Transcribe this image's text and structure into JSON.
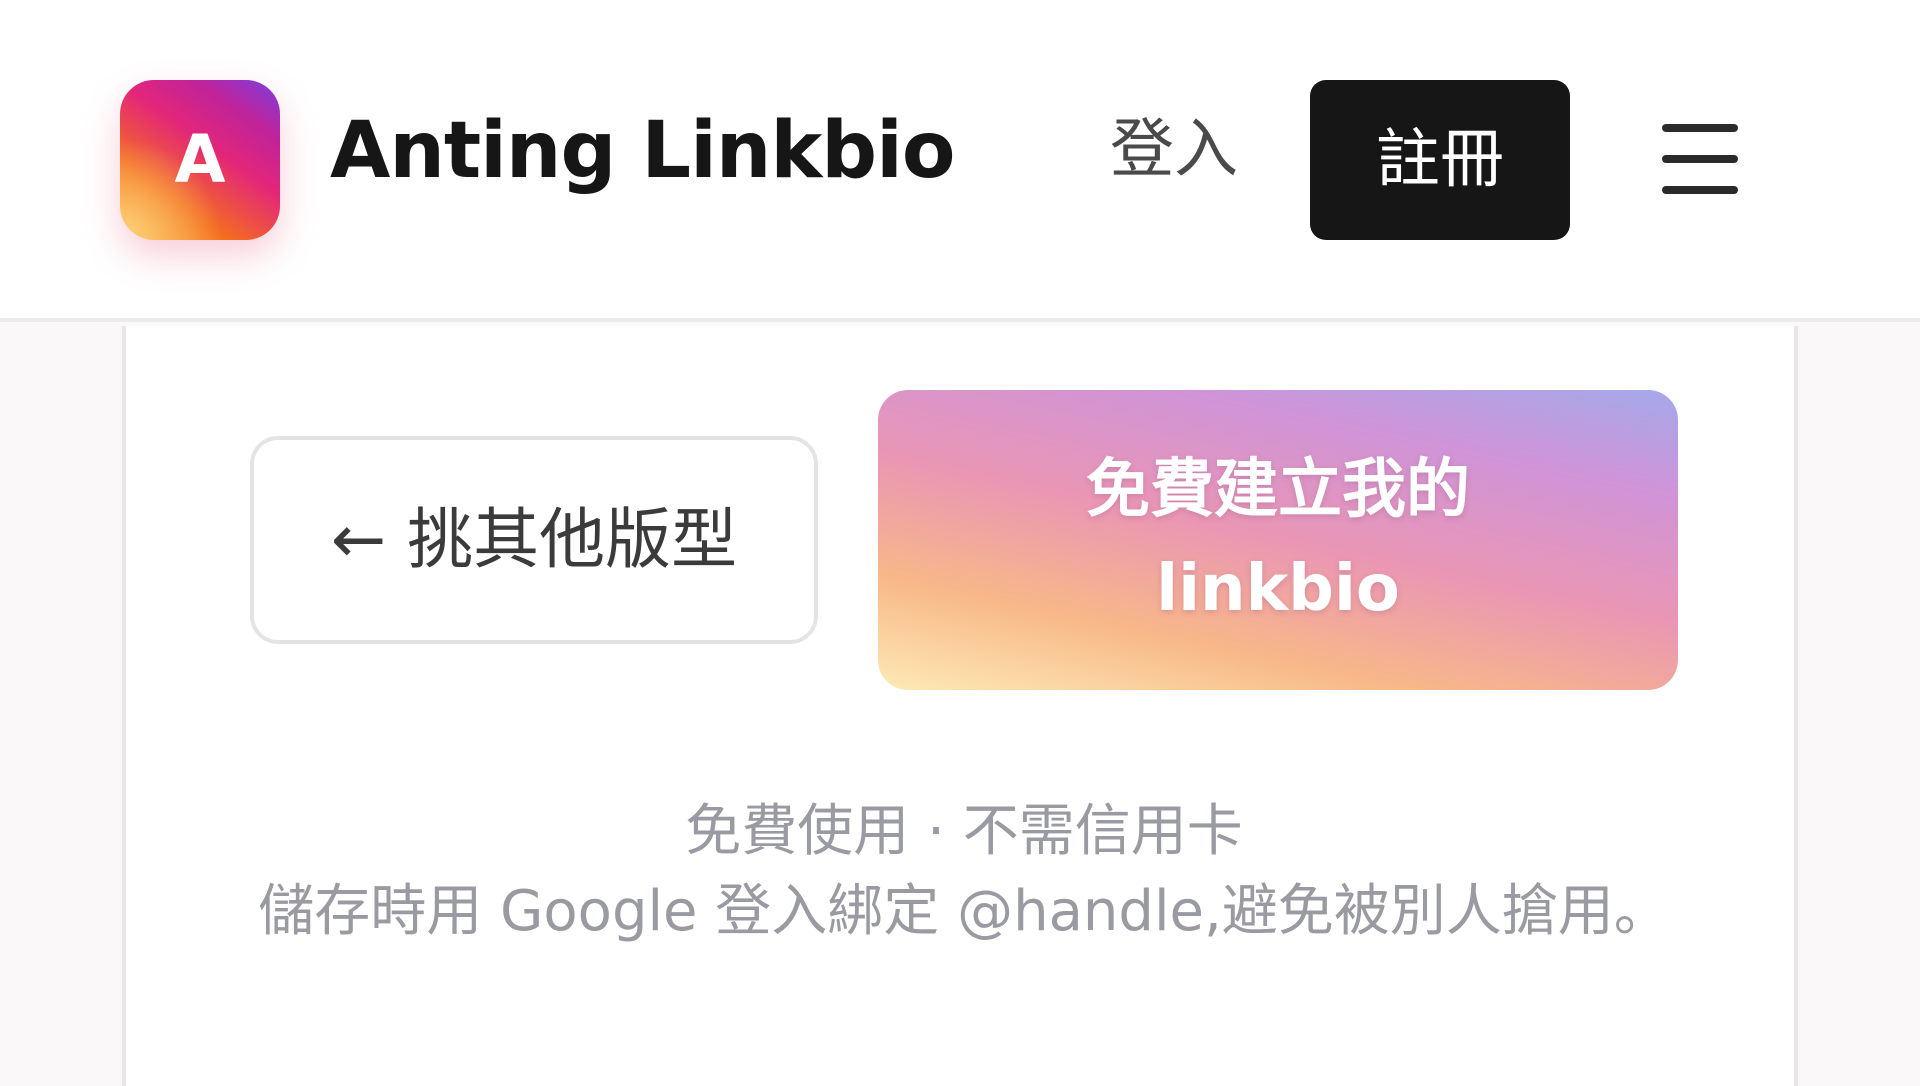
{
  "header": {
    "logo_letter": "A",
    "brand_name": "Anting Linkbio",
    "login_label": "登入",
    "signup_label": "註冊",
    "menu_icon": "hamburger-menu-icon"
  },
  "main": {
    "back_label": "← 挑其他版型",
    "cta_line1": "免費建立我的",
    "cta_line2": "linkbio",
    "note_line1": "免費使用 · 不需信用卡",
    "note_line2": "儲存時用 Google 登入綁定 @handle,避免被別人搶用。"
  },
  "colors": {
    "signup_bg": "#161616",
    "text_primary": "#161616",
    "text_muted": "#9a9aa3"
  }
}
